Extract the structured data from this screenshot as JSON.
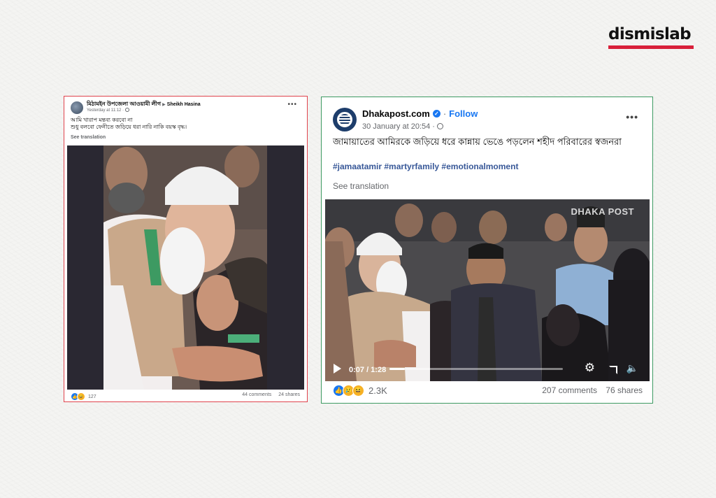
{
  "brand": {
    "logo_text": "dismislab",
    "accent_color": "#d8203a"
  },
  "left_post": {
    "border_color": "#e0434d",
    "page_name": "মিঠামইন উপজেলা আওয়ামী লীগ",
    "target_name": "Sheikh Hasina",
    "timestamp": "Yesterday at 11:12 · ",
    "text_line_1": "আমি খারাপ মন্তব্য করবো না",
    "text_line_2": "শুধু বলবো ফেনীতে জড়িয়ে ধরা নারি নাকি বয়স্ক বৃদ্ধ।",
    "see_translation": "See translation",
    "reaction_count": "127",
    "comments": "44 comments",
    "shares": "24 shares",
    "more_icon": "more-dots-icon"
  },
  "right_post": {
    "border_color": "#3d9a62",
    "page_name": "Dhakapost.com",
    "follow_label": "Follow",
    "timestamp": "30 January at 20:54 · ",
    "text": "জামায়াতের আমিরকে জড়িয়ে ধরে কান্নায় ভেঙে পড়লেন শহীদ পরিবারের স্বজনরা",
    "hashtags": "#jamaatamir #martyrfamily #emotionalmoment",
    "see_translation": "See translation",
    "video_watermark": "DHAKA POST",
    "video_time": "0:07 / 1:28",
    "video_progress": 0.09,
    "reaction_count": "2.3K",
    "comments": "207 comments",
    "shares": "76 shares",
    "more_icon": "more-dots-icon"
  }
}
